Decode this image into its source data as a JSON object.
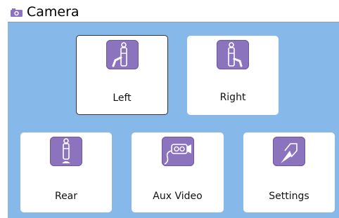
{
  "window": {
    "title": "Camera",
    "title_icon": "camera-icon"
  },
  "colors": {
    "panel_background": "#86b9ea",
    "icon_background": "#8c73bd",
    "tile_background": "#ffffff"
  },
  "tiles": [
    {
      "label": "Left",
      "icon": "left-camera-icon",
      "selected": true
    },
    {
      "label": "Right",
      "icon": "right-camera-icon",
      "selected": false
    },
    {
      "label": "Rear",
      "icon": "rear-camera-icon",
      "selected": false
    },
    {
      "label": "Aux Video",
      "icon": "aux-video-icon",
      "selected": false
    },
    {
      "label": "Settings",
      "icon": "settings-icon",
      "selected": false
    }
  ]
}
